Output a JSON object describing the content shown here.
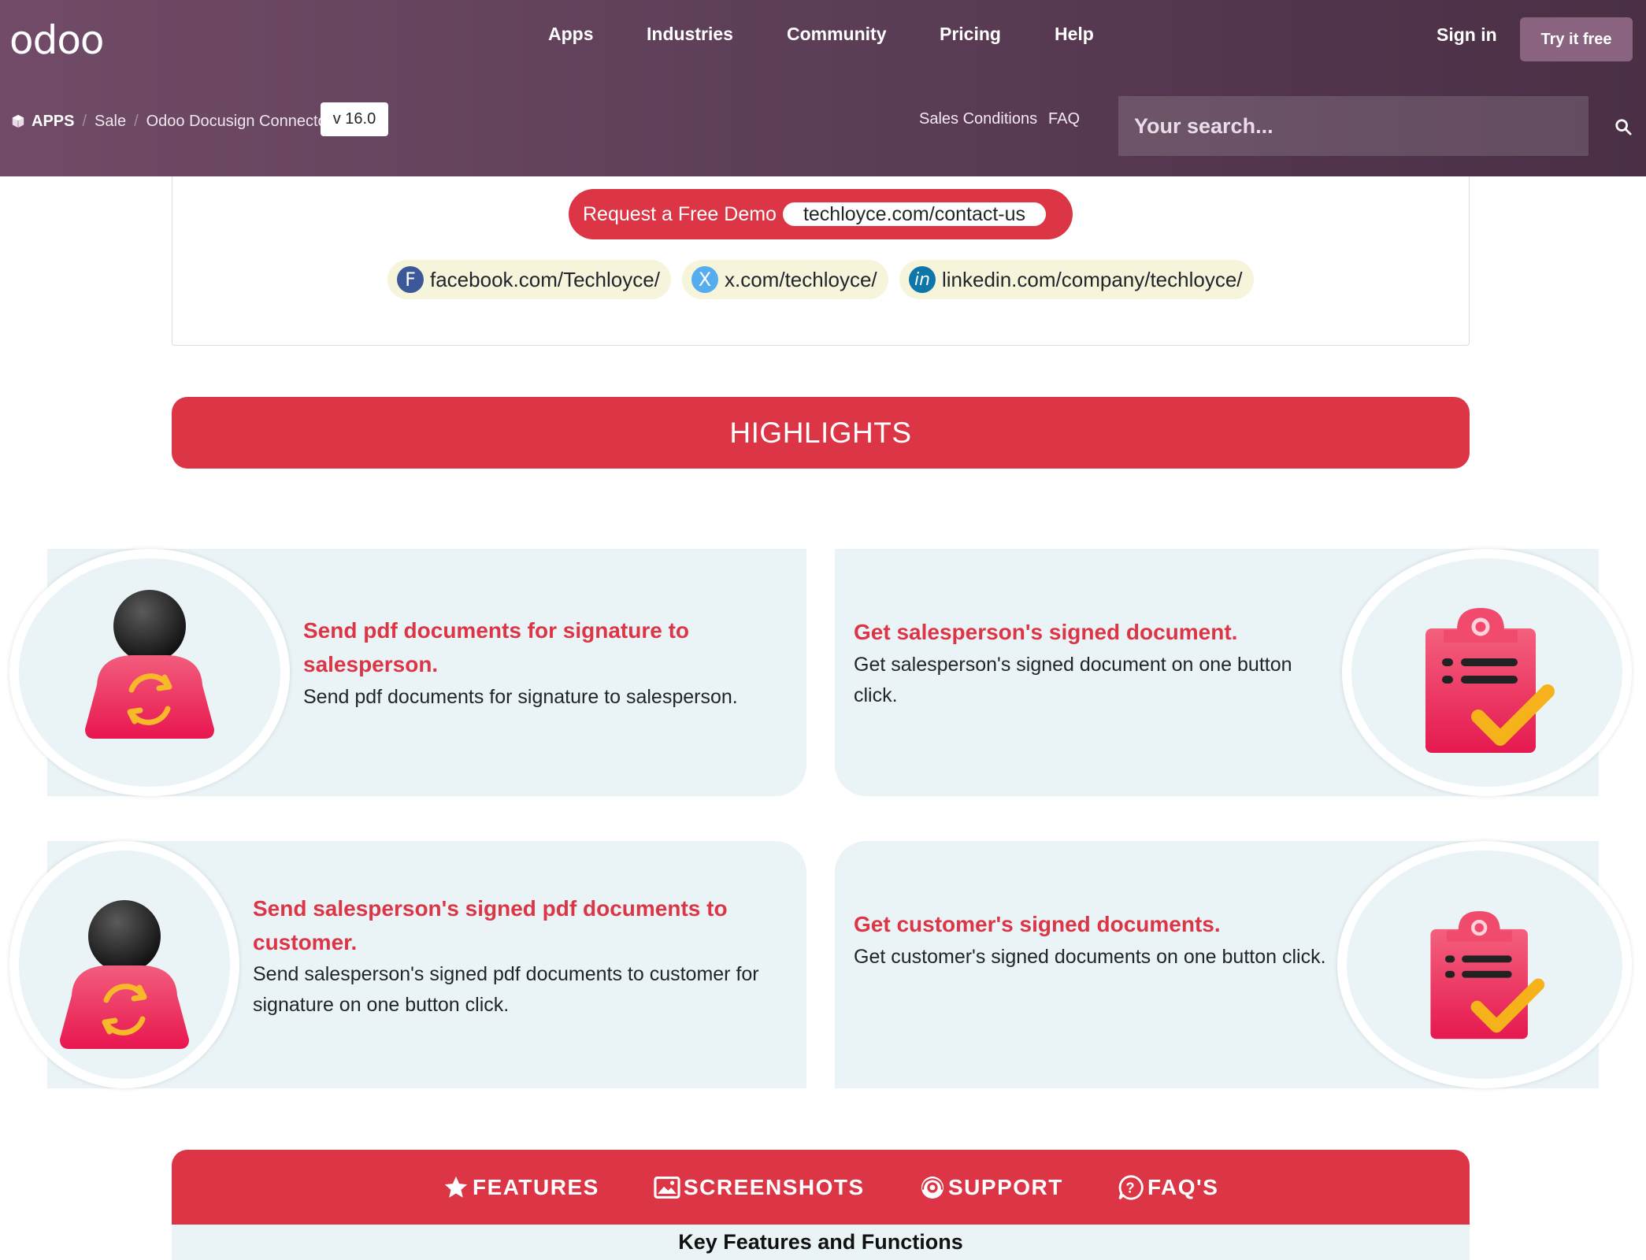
{
  "header": {
    "logo": "odoo",
    "nav": [
      "Apps",
      "Industries",
      "Community",
      "Pricing",
      "Help"
    ],
    "sign_in": "Sign in",
    "try_free": "Try it free",
    "breadcrumb": {
      "apps": "APPS",
      "category": "Sale",
      "module": "Odoo Docusign Connector"
    },
    "version": "v 16.0",
    "links": {
      "sales_conditions": "Sales Conditions",
      "faq": "FAQ"
    },
    "search_placeholder": "Your search..."
  },
  "contact": {
    "demo_label": "Request a Free Demo",
    "demo_url": "techloyce.com/contact-us",
    "socials": [
      {
        "icon": "F",
        "icon_color": "#3b5998",
        "label": "facebook.com/Techloyce/"
      },
      {
        "icon": "X",
        "icon_color": "#55acee",
        "label": "x.com/techloyce/"
      },
      {
        "icon": "in",
        "icon_color": "#0e76a8",
        "label": "linkedin.com/company/techloyce/"
      }
    ]
  },
  "highlights": {
    "heading": "HIGHLIGHTS",
    "items": [
      {
        "title": "Send pdf documents for signature to salesperson.",
        "desc": "Send pdf documents for signature to salesperson.",
        "icon": "person-sync-icon"
      },
      {
        "title": "Get salesperson's signed document.",
        "desc": "Get salesperson's signed document on one button click.",
        "icon": "clipboard-check-icon"
      },
      {
        "title": "Send salesperson's signed pdf documents to customer.",
        "desc": "Send salesperson's signed pdf documents to customer for signature on one button click.",
        "icon": "person-sync-icon"
      },
      {
        "title": "Get customer's signed documents.",
        "desc": "Get customer's signed documents on one button click.",
        "icon": "clipboard-check-icon"
      }
    ]
  },
  "tabs": [
    {
      "label": "FEATURES",
      "icon": "star-icon"
    },
    {
      "label": "SCREENSHOTS",
      "icon": "image-icon"
    },
    {
      "label": "SUPPORT",
      "icon": "support-icon"
    },
    {
      "label": "FAQ'S",
      "icon": "question-icon"
    }
  ],
  "key_features_title": "Key Features and Functions",
  "colors": {
    "brand": "#714b67",
    "accent": "#dc3545",
    "card_bg": "#eaf4f7"
  }
}
